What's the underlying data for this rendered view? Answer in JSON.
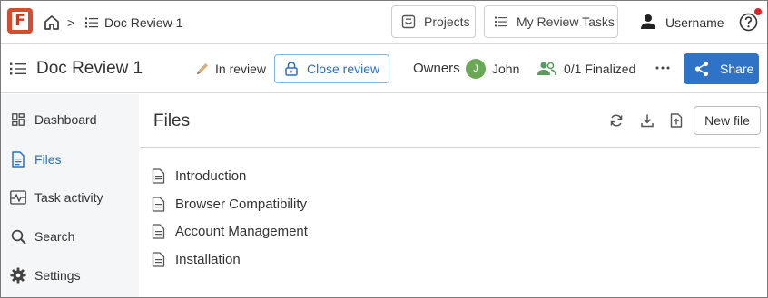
{
  "app": {
    "logo_letter": "F",
    "breadcrumb": {
      "home_icon": "home-icon",
      "separator": ">",
      "current": "Doc Review 1"
    }
  },
  "topnav": {
    "projects_label": "Projects",
    "my_review_tasks_label": "My Review Tasks",
    "username": "Username",
    "help_icon": "question-circle-icon",
    "notification_color": "#e0202a"
  },
  "docbar": {
    "title": "Doc Review 1",
    "status": "In review",
    "close_review_label": "Close review",
    "owners_label": "Owners",
    "owner": {
      "initial": "J",
      "name": "John",
      "avatar_color": "#6aa756"
    },
    "finalized": "0/1 Finalized",
    "more_label": "···",
    "share_label": "Share",
    "accent": "#2f73c7"
  },
  "sidebar": {
    "items": [
      {
        "label": "Dashboard",
        "icon": "dashboard-icon",
        "active": false
      },
      {
        "label": "Files",
        "icon": "file-icon",
        "active": true
      },
      {
        "label": "Task activity",
        "icon": "activity-icon",
        "active": false
      },
      {
        "label": "Search",
        "icon": "search-icon",
        "active": false
      },
      {
        "label": "Settings",
        "icon": "gear-icon",
        "active": false
      }
    ]
  },
  "main": {
    "title": "Files",
    "new_file_label": "New file",
    "files": [
      {
        "name": "Introduction"
      },
      {
        "name": "Browser Compatibility"
      },
      {
        "name": "Account Management"
      },
      {
        "name": "Installation"
      }
    ]
  }
}
